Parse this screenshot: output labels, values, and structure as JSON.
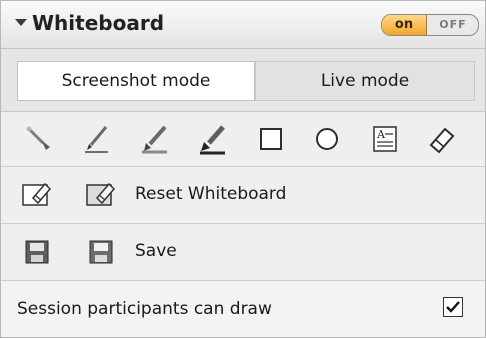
{
  "header": {
    "title": "Whiteboard",
    "toggle_on": "on",
    "toggle_off": "OFF"
  },
  "modes": {
    "screenshot": "Screenshot mode",
    "live": "Live mode"
  },
  "actions": {
    "reset_label": "Reset Whiteboard",
    "save_label": "Save"
  },
  "permissions": {
    "participants_draw_label": "Session participants can draw",
    "participants_draw_checked": true
  },
  "icons": [
    "pointer-icon",
    "pen-icon",
    "highlighter-icon",
    "marker-icon",
    "rectangle-icon",
    "ellipse-icon",
    "text-icon",
    "eraser-icon"
  ],
  "colors": {
    "toggle_on": "#f2a52b",
    "panel_bg": "#efefef"
  }
}
